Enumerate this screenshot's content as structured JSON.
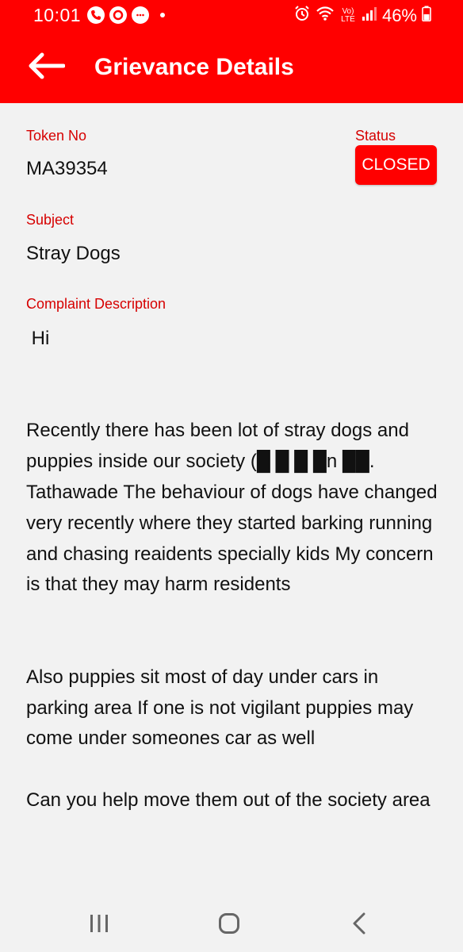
{
  "status_bar": {
    "time": "10:01",
    "battery_percent": "46%",
    "network_label": "Vo) LTE",
    "color": "#ff0000"
  },
  "app_bar": {
    "title": "Grievance Details",
    "back_icon": "arrow-left-icon",
    "color": "#ff0000"
  },
  "grievance": {
    "token_label": "Token No",
    "token_value": "MA39354",
    "status_label": "Status",
    "status_value": "CLOSED",
    "subject_label": "Subject",
    "subject_value": "Stray Dogs",
    "description_label": "Complaint Description",
    "description_text": " Hi\n\n\nRecently there has been lot of stray dogs and puppies inside our society (█ █ █ █n ██. Tathawade The behaviour of dogs have changed very recently where they started barking running and chasing reaidents specially kids My concern is that they may harm residents\n\n\nAlso puppies sit most of day under cars in parking area If one is not vigilant puppies may come under someones car as well\n\nCan you help move them out of the society area"
  },
  "nav_bar": {
    "recents_icon": "recents-icon",
    "home_icon": "home-icon",
    "back_icon": "nav-back-icon"
  }
}
